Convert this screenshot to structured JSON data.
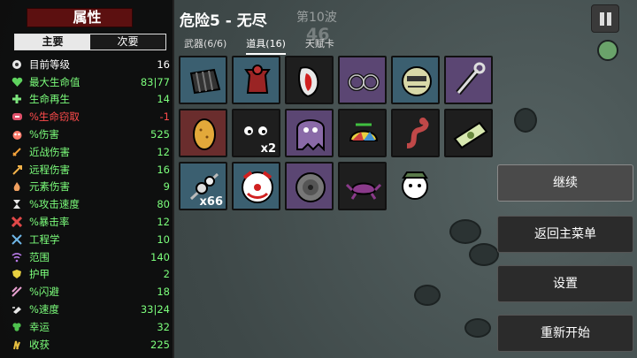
{
  "stats_panel": {
    "title": "属性",
    "tabs": [
      {
        "label": "主要",
        "active": true
      },
      {
        "label": "次要",
        "active": false
      }
    ],
    "stats": [
      {
        "icon": "level-icon",
        "label": "目前等级",
        "value": "16",
        "color": "#ffffff"
      },
      {
        "icon": "heart-icon",
        "label": "最大生命值",
        "value": "83|77",
        "color": "#7cff7c"
      },
      {
        "icon": "regen-icon",
        "label": "生命再生",
        "value": "14",
        "color": "#7cff7c"
      },
      {
        "icon": "lifesteal-icon",
        "label": "%生命窃取",
        "value": "-1",
        "color": "#ff4b4b"
      },
      {
        "icon": "damage-icon",
        "label": "%伤害",
        "value": "525",
        "color": "#7cff7c"
      },
      {
        "icon": "melee-icon",
        "label": "近战伤害",
        "value": "12",
        "color": "#7cff7c"
      },
      {
        "icon": "ranged-icon",
        "label": "远程伤害",
        "value": "16",
        "color": "#7cff7c"
      },
      {
        "icon": "elemental-icon",
        "label": "元素伤害",
        "value": "9",
        "color": "#7cff7c"
      },
      {
        "icon": "attack-speed-icon",
        "label": "%攻击速度",
        "value": "80",
        "color": "#7cff7c"
      },
      {
        "icon": "crit-icon",
        "label": "%暴击率",
        "value": "12",
        "color": "#7cff7c"
      },
      {
        "icon": "engineering-icon",
        "label": "工程学",
        "value": "10",
        "color": "#7cff7c"
      },
      {
        "icon": "range-icon",
        "label": "范围",
        "value": "140",
        "color": "#7cff7c"
      },
      {
        "icon": "armor-icon",
        "label": "护甲",
        "value": "2",
        "color": "#7cff7c"
      },
      {
        "icon": "dodge-icon",
        "label": "%闪避",
        "value": "18",
        "color": "#7cff7c"
      },
      {
        "icon": "speed-icon",
        "label": "%速度",
        "value": "33|24",
        "color": "#7cff7c"
      },
      {
        "icon": "luck-icon",
        "label": "幸运",
        "value": "32",
        "color": "#7cff7c"
      },
      {
        "icon": "harvest-icon",
        "label": "收获",
        "value": "225",
        "color": "#7cff7c"
      }
    ]
  },
  "header": {
    "title": "危险5 - 无尽",
    "wave": "第10波",
    "timer": "46"
  },
  "item_tabs": [
    {
      "label": "武器(6/6)",
      "active": false
    },
    {
      "label": "道具(16)",
      "active": true
    },
    {
      "label": "天赋卡",
      "active": false
    }
  ],
  "items": [
    {
      "name": "item-grate-icon",
      "tier": "t-blue",
      "count": ""
    },
    {
      "name": "item-scarecrow-icon",
      "tier": "t-blue",
      "count": ""
    },
    {
      "name": "item-red-tongue-icon",
      "tier": "t-dark",
      "count": ""
    },
    {
      "name": "item-handcuffs-icon",
      "tier": "t-purple",
      "count": ""
    },
    {
      "name": "item-robot-head-icon",
      "tier": "t-blue",
      "count": ""
    },
    {
      "name": "item-tool-icon",
      "tier": "t-purple",
      "count": ""
    },
    {
      "name": "item-potato-icon",
      "tier": "t-red",
      "count": ""
    },
    {
      "name": "item-eyes-icon",
      "tier": "t-dark",
      "count": "x2"
    },
    {
      "name": "item-ghost-icon",
      "tier": "t-purple",
      "count": ""
    },
    {
      "name": "item-propeller-hat-icon",
      "tier": "t-dark",
      "count": ""
    },
    {
      "name": "item-snake-icon",
      "tier": "t-dark",
      "count": ""
    },
    {
      "name": "item-banknote-icon",
      "tier": "t-dark",
      "count": ""
    },
    {
      "name": "item-kebab-icon",
      "tier": "t-blue",
      "count": "x66"
    },
    {
      "name": "item-clown-icon",
      "tier": "t-blue",
      "count": ""
    },
    {
      "name": "item-sawblade-icon",
      "tier": "t-purple",
      "count": ""
    },
    {
      "name": "item-crab-icon",
      "tier": "t-dark",
      "count": ""
    },
    {
      "name": "item-alien-icon",
      "tier": "none",
      "count": ""
    }
  ],
  "menu": {
    "continue": "继续",
    "main_menu": "返回主菜单",
    "settings": "设置",
    "restart": "重新开始"
  }
}
